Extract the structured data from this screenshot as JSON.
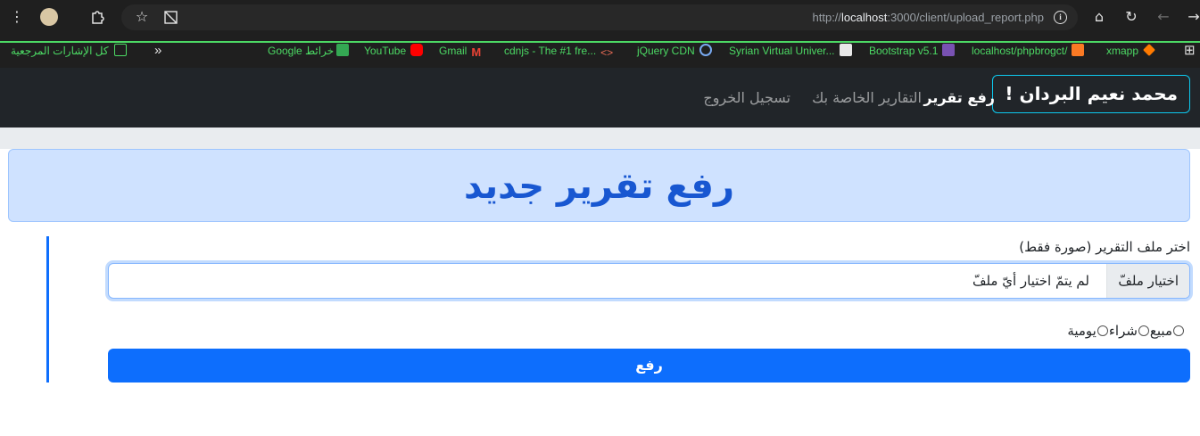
{
  "browser": {
    "url_prefix": "http://",
    "url_host": "localhost",
    "url_rest": ":3000/client/upload_report.php"
  },
  "bookmarks": [
    {
      "label": "كل الإشارات المرجعية",
      "icon": "folder-icon"
    },
    {
      "label": "خرائط Google",
      "icon": "maps-icon"
    },
    {
      "label": "YouTube",
      "icon": "youtube-icon"
    },
    {
      "label": "Gmail",
      "icon": "gmail-icon"
    },
    {
      "label": "cdnjs - The #1 fre...",
      "icon": "code-icon"
    },
    {
      "label": "jQuery CDN",
      "icon": "jquery-icon"
    },
    {
      "label": "Syrian Virtual Univer...",
      "icon": "svu-icon"
    },
    {
      "label": "Bootstrap v5.1",
      "icon": "bootstrap-icon"
    },
    {
      "label": "localhost/phpbrogct/",
      "icon": "xampp-icon"
    },
    {
      "label": "xmapp",
      "icon": "xampp-diamond-icon"
    }
  ],
  "navbar": {
    "brand": "محمد نعيم البردان !",
    "links": [
      "رفع تقرير",
      "التقارير الخاصة بك",
      "تسجيل الخروج"
    ]
  },
  "page": {
    "heading": "رفع تقرير جديد",
    "file_label": "اختر ملف التقرير (صورة فقط)",
    "file_button": "اختيار ملفّ",
    "file_status": "لم يتمّ اختيار أيّ ملفّ",
    "radios": [
      "مبيع",
      "شراء",
      "يومية"
    ],
    "submit": "رفع"
  },
  "colors": {
    "primary": "#0d6efd",
    "alert_bg": "#cfe2ff",
    "heading": "#1857d1",
    "navbar_bg": "#212529",
    "brand_border": "#0dcaf0",
    "bookmark_text": "#4cd964"
  }
}
